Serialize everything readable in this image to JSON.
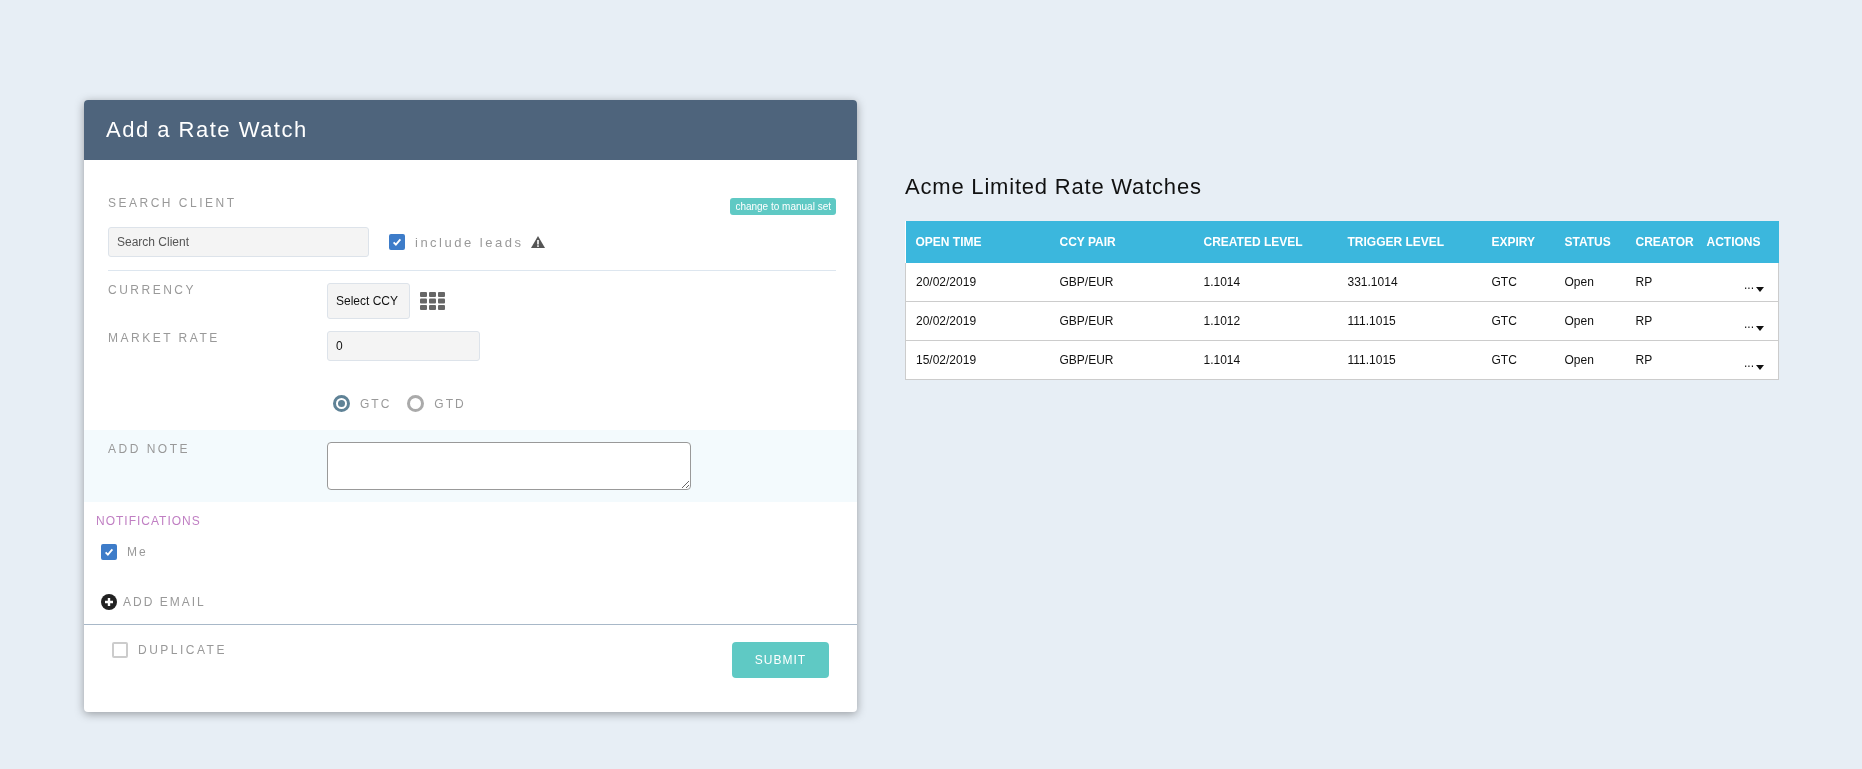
{
  "dialog": {
    "title": "Add a Rate Watch",
    "search_client": {
      "label": "SEARCH CLIENT",
      "manual_button": "change to manual set",
      "placeholder": "Search Client",
      "include_leads": {
        "label": "include leads",
        "checked": true
      }
    },
    "currency": {
      "label": "CURRENCY",
      "select": "Select CCY"
    },
    "market_rate": {
      "label": "MARKET RATE",
      "value": "0"
    },
    "expiry_options": [
      {
        "label": "GTC",
        "selected": true
      },
      {
        "label": "GTD",
        "selected": false
      }
    ],
    "note": {
      "label": "ADD NOTE"
    },
    "notifications": {
      "title": "NOTIFICATIONS",
      "recipients": [
        {
          "label": "Me",
          "checked": true
        }
      ],
      "add_email": "ADD EMAIL"
    },
    "duplicate": {
      "label": "DUPLICATE",
      "checked": false
    },
    "submit": "SUBMIT"
  },
  "rate_watches": {
    "title": "Acme Limited Rate Watches",
    "columns": [
      "OPEN TIME",
      "CCY PAIR",
      "CREATED LEVEL",
      "TRIGGER LEVEL",
      "EXPIRY",
      "STATUS",
      "CREATOR",
      "ACTIONS"
    ],
    "rows": [
      {
        "cells": [
          "20/02/2019",
          "GBP/EUR",
          "1.1014",
          "331.1014",
          "GTC",
          "Open",
          "RP"
        ],
        "actions": "..."
      },
      {
        "cells": [
          "20/02/2019",
          "GBP/EUR",
          "1.1012",
          "111.1015",
          "GTC",
          "Open",
          "RP"
        ],
        "actions": "..."
      },
      {
        "cells": [
          "15/02/2019",
          "GBP/EUR",
          "1.1014",
          "111.1015",
          "GTC",
          "Open",
          "RP"
        ],
        "actions": "..."
      }
    ]
  }
}
